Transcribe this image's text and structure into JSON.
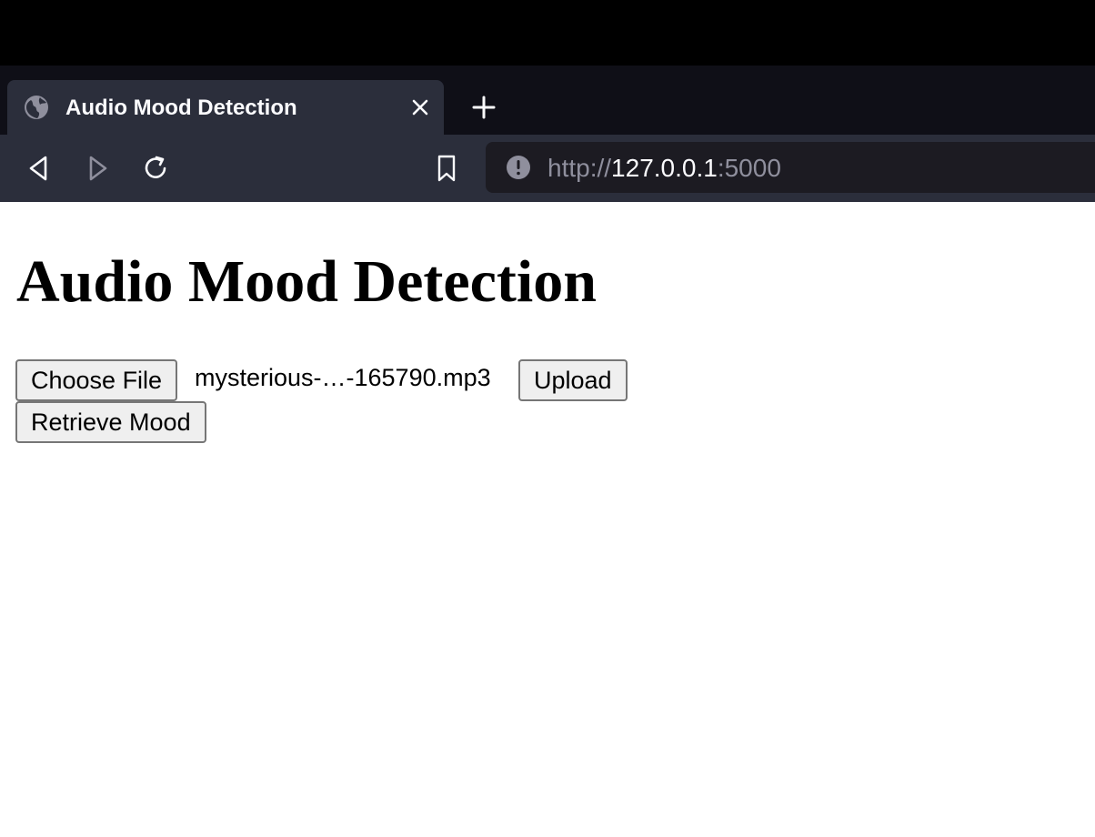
{
  "browser": {
    "tab": {
      "title": "Audio Mood Detection",
      "favicon": "globe-icon",
      "close_icon": "close-icon"
    },
    "new_tab_icon": "plus-icon",
    "nav": {
      "back_icon": "back-arrow-icon",
      "forward_icon": "forward-arrow-icon",
      "reload_icon": "reload-icon",
      "bookmark_icon": "bookmark-icon"
    },
    "url": {
      "info_icon": "info-icon",
      "scheme": "http://",
      "host": "127.0.0.1",
      "port": ":5000"
    }
  },
  "page": {
    "heading": "Audio Mood Detection",
    "file_input": {
      "button_label": "Choose File",
      "file_name": "mysterious-…-165790.mp3"
    },
    "upload_label": "Upload",
    "retrieve_label": "Retrieve Mood"
  },
  "colors": {
    "tabstrip_bg": "#0f0f17",
    "toolbar_bg": "#2b2e3b",
    "urlbar_bg": "#1c1b22",
    "button_bg": "#efefef",
    "button_border": "#767676"
  }
}
